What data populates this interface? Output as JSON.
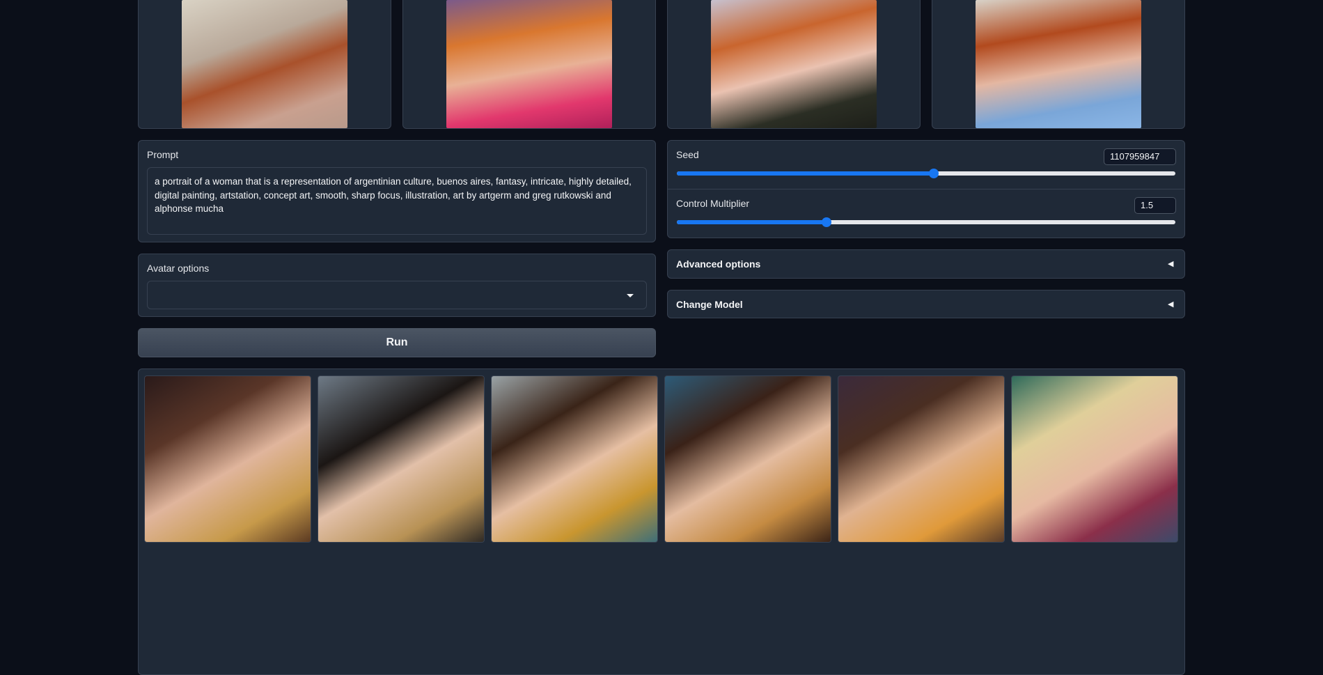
{
  "avatars": [
    {
      "name": "avatar-photo-1"
    },
    {
      "name": "avatar-photo-2"
    },
    {
      "name": "avatar-photo-3"
    },
    {
      "name": "avatar-photo-4"
    }
  ],
  "prompt": {
    "label": "Prompt",
    "value": "a portrait of a woman that is a representation of argentinian culture, buenos aires, fantasy, intricate, highly detailed, digital painting, artstation, concept art, smooth, sharp focus, illustration, art by artgerm and greg rutkowski and alphonse mucha"
  },
  "seed": {
    "label": "Seed",
    "value": "1107959847",
    "fraction": 0.516
  },
  "control_multiplier": {
    "label": "Control Multiplier",
    "value": "1.5",
    "fraction": 0.3
  },
  "avatar_options": {
    "label": "Avatar options",
    "selected": ""
  },
  "advanced_options": {
    "label": "Advanced options",
    "icon": "triangle-left-icon"
  },
  "change_model": {
    "label": "Change Model",
    "icon": "triangle-left-icon"
  },
  "run": {
    "label": "Run"
  },
  "colors": {
    "background": "#0b0f19",
    "panel": "#1f2937",
    "accent": "#1877f2"
  }
}
